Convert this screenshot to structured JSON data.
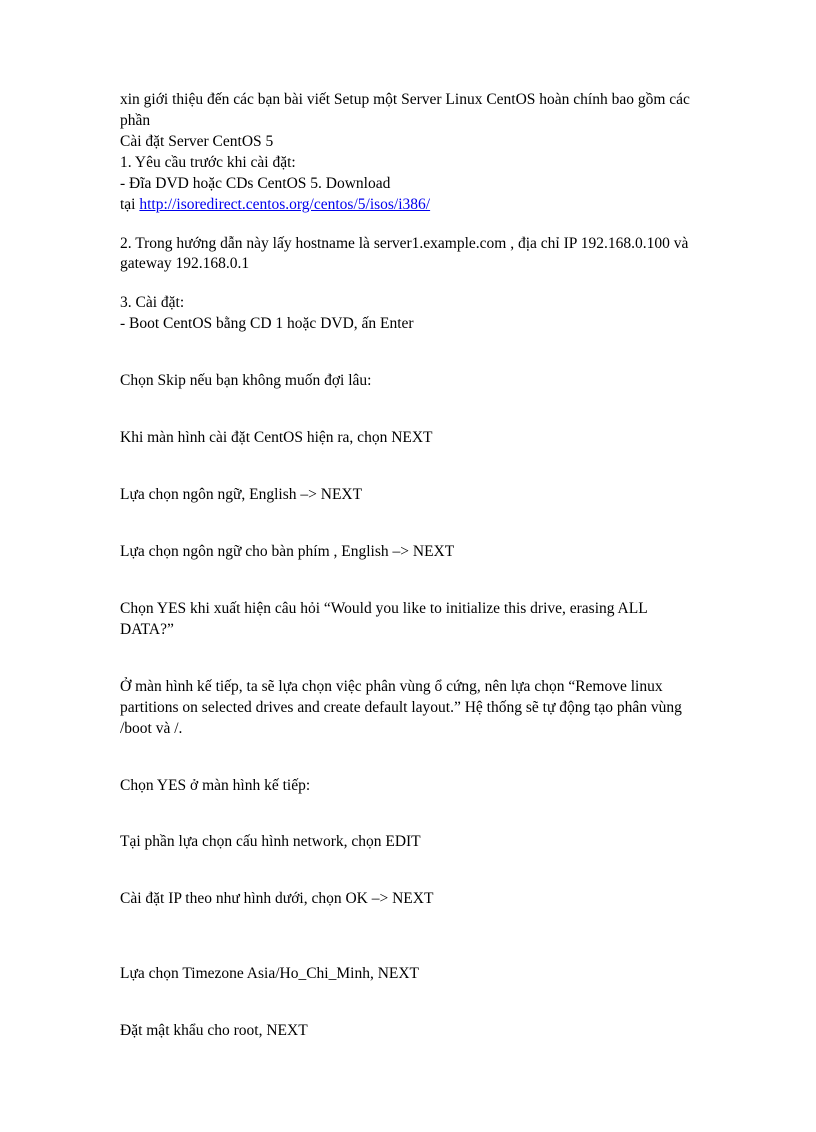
{
  "intro": "xin giới thiệu đến các bạn bài viết Setup một Server Linux CentOS hoàn chính bao gồm các phần",
  "line2": "Cài đặt Server CentOS 5",
  "line3": "1. Yêu cầu trước khi cài đặt:",
  "line4": "- Đĩa DVD hoặc CDs CentOS 5. Download",
  "line5_prefix": "tại ",
  "link_text": "http://isoredirect.centos.org/centos/5/isos/i386/",
  "para2": "2. Trong hướng dẫn này lấy hostname là server1.example.com , địa chỉ IP 192.168.0.100 và gateway 192.168.0.1",
  "para3a": "3. Cài đặt:",
  "para3b": "- Boot CentOS bằng CD 1 hoặc DVD, ấn Enter",
  "p4": "Chọn Skip nếu bạn không muốn đợi lâu:",
  "p5": "Khi màn hình cài đặt CentOS hiện ra, chọn NEXT",
  "p6": "Lựa chọn ngôn ngữ, English –> NEXT",
  "p7": "Lựa chọn ngôn ngữ cho bàn phím , English –> NEXT",
  "p8": "Chọn YES khi xuất hiện câu hỏi “Would you like to initialize this drive, erasing ALL DATA?”",
  "p9": "Ở màn hình kế tiếp, ta sẽ lựa chọn việc phân vùng ổ cứng, nên lựa chọn “Remove linux partitions on selected drives and create default layout.” Hệ thống sẽ tự động tạo phân vùng /boot và /.",
  "p10": "Chọn YES ở màn hình kế tiếp:",
  "p11": "Tại phần lựa chọn cấu hình network, chọn EDIT",
  "p12": "Cài đặt IP theo như hình dưới, chọn OK –> NEXT",
  "p13": "Lựa chọn Timezone Asia/Ho_Chi_Minh, NEXT",
  "p14": "Đặt mật khẩu cho root, NEXT"
}
